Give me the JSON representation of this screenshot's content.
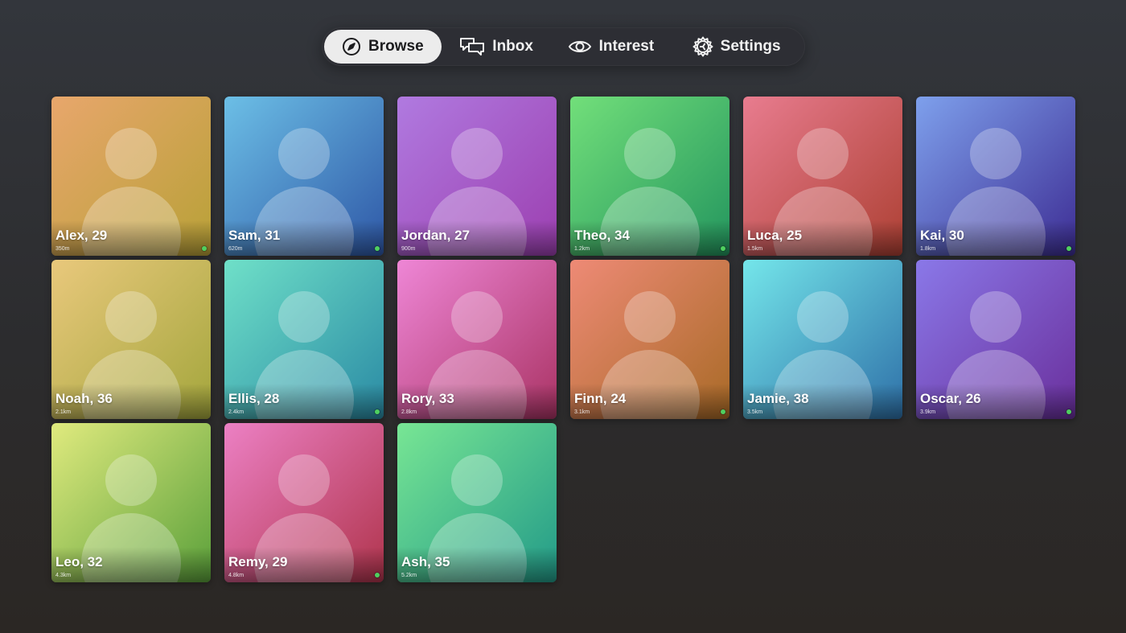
{
  "nav": {
    "tabs": [
      {
        "label": "Browse",
        "icon": "compass-icon",
        "active": true
      },
      {
        "label": "Inbox",
        "icon": "chat-bubbles-icon",
        "active": false
      },
      {
        "label": "Interest",
        "icon": "eye-icon",
        "active": false
      },
      {
        "label": "Settings",
        "icon": "gear-icon",
        "active": false
      }
    ]
  },
  "profiles": [
    {
      "name": "Alex, 29",
      "distance": "350m",
      "online": true,
      "colors": [
        "#e8a66c",
        "#b8a137"
      ]
    },
    {
      "name": "Sam, 31",
      "distance": "620m",
      "online": true,
      "colors": [
        "#6cbfe6",
        "#2e57a6"
      ]
    },
    {
      "name": "Jordan, 27",
      "distance": "900m",
      "online": false,
      "colors": [
        "#b07ae0",
        "#9c3fb0"
      ]
    },
    {
      "name": "Theo, 34",
      "distance": "1.2km",
      "online": true,
      "colors": [
        "#72df7a",
        "#23955e"
      ]
    },
    {
      "name": "Luca, 25",
      "distance": "1.5km",
      "online": false,
      "colors": [
        "#e87c8f",
        "#ad4033"
      ]
    },
    {
      "name": "Kai, 30",
      "distance": "1.8km",
      "online": true,
      "colors": [
        "#7ea0ec",
        "#3d2d94"
      ]
    },
    {
      "name": "Noah, 36",
      "distance": "2.1km",
      "online": false,
      "colors": [
        "#e9c87c",
        "#a3a63c"
      ]
    },
    {
      "name": "Ellis, 28",
      "distance": "2.4km",
      "online": true,
      "colors": [
        "#6fe0c8",
        "#2a8aa4"
      ]
    },
    {
      "name": "Rory, 33",
      "distance": "2.8km",
      "online": false,
      "colors": [
        "#ee86d6",
        "#aa3364"
      ]
    },
    {
      "name": "Finn, 24",
      "distance": "3.1km",
      "online": true,
      "colors": [
        "#ee8a76",
        "#a86a26"
      ]
    },
    {
      "name": "Jamie, 38",
      "distance": "3.5km",
      "online": false,
      "colors": [
        "#74e6ea",
        "#2e70a8"
      ]
    },
    {
      "name": "Oscar, 26",
      "distance": "3.9km",
      "online": true,
      "colors": [
        "#8a78e8",
        "#6a2f9c"
      ]
    },
    {
      "name": "Leo, 32",
      "distance": "4.3km",
      "online": false,
      "colors": [
        "#e0ea7e",
        "#5aa03a"
      ]
    },
    {
      "name": "Remy, 29",
      "distance": "4.8km",
      "online": true,
      "colors": [
        "#ec80c4",
        "#b0344c"
      ]
    },
    {
      "name": "Ash, 35",
      "distance": "5.2km",
      "online": false,
      "colors": [
        "#78e694",
        "#229a88"
      ]
    }
  ]
}
